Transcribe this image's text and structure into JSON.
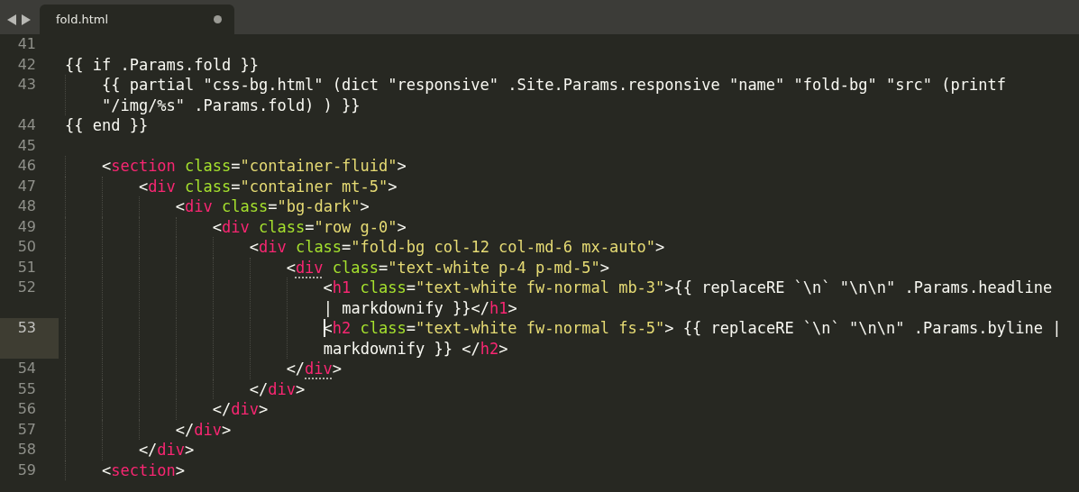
{
  "tabs": [
    {
      "label": "fold.html",
      "selected": true,
      "modified": true
    }
  ],
  "lines": [
    {
      "number": "41",
      "current": false
    },
    {
      "number": "42",
      "current": false,
      "rows": [
        "{{ if .Params.fold }}"
      ]
    },
    {
      "number": "43",
      "current": false,
      "rows": [
        "    {{ partial \"css-bg.html\" (dict \"responsive\" .Site.Params.responsive \"name\" \"fold-bg\" \"src\" (printf",
        "\"/img/%s\" .Params.fold) ) }}"
      ]
    },
    {
      "number": "44",
      "current": false,
      "rows": [
        "{{ end }}"
      ]
    },
    {
      "number": "45",
      "current": false
    },
    {
      "number": "46",
      "current": false,
      "rows": [
        "    <section class=\"container-fluid\">"
      ]
    },
    {
      "number": "47",
      "current": false,
      "rows": [
        "        <div class=\"container mt-5\">"
      ]
    },
    {
      "number": "48",
      "current": false,
      "rows": [
        "            <div class=\"bg-dark\">"
      ]
    },
    {
      "number": "49",
      "current": false,
      "rows": [
        "                <div class=\"row g-0\">"
      ]
    },
    {
      "number": "50",
      "current": false,
      "rows": [
        "                    <div class=\"fold-bg col-12 col-md-6 mx-auto\">"
      ]
    },
    {
      "number": "51",
      "current": false,
      "tag_matched": true,
      "rows": [
        "                        <div class=\"text-white p-4 p-md-5\">"
      ]
    },
    {
      "number": "52",
      "current": false,
      "rows": [
        "                            <h1 class=\"text-white fw-normal mb-3\">{{ replaceRE `\\n` \"\\n\\n\" .Params.headline",
        "| markdownify }}</h1>"
      ]
    },
    {
      "number": "53",
      "current": true,
      "rows": [
        "                            <h2 class=\"text-white fw-normal fs-5\"> {{ replaceRE `\\n` \"\\n\\n\" .Params.byline |",
        "markdownify }} </h2>"
      ]
    },
    {
      "number": "54",
      "current": false,
      "tag_matched": true,
      "rows": [
        "                        </div>"
      ]
    },
    {
      "number": "55",
      "current": false,
      "rows": [
        "                    </div>"
      ]
    },
    {
      "number": "56",
      "current": false,
      "rows": [
        "                </div>"
      ]
    },
    {
      "number": "57",
      "current": false,
      "rows": [
        "            </div>"
      ]
    },
    {
      "number": "58",
      "current": false,
      "rows": [
        "        </div>"
      ]
    },
    {
      "number": "59",
      "current": false,
      "rows": [
        "    <section>"
      ]
    }
  ]
}
